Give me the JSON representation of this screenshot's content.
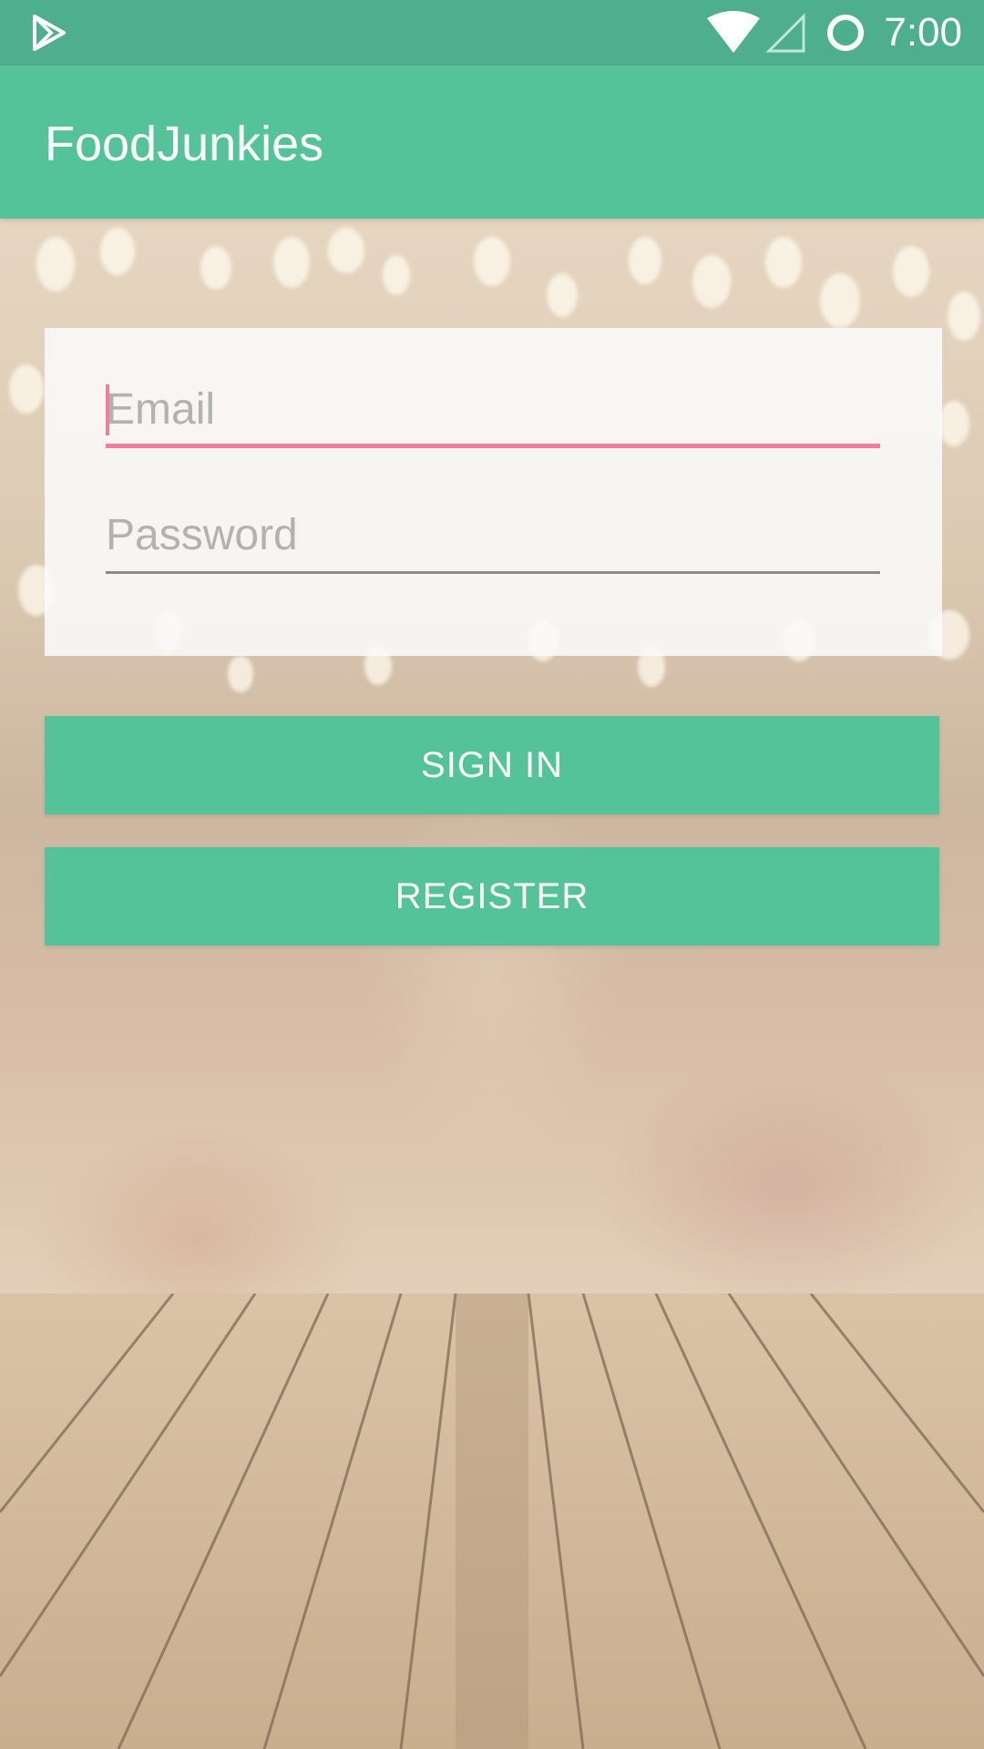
{
  "status_bar": {
    "time": "7:00",
    "icons": [
      "play-store-icon",
      "wifi-icon",
      "cell-signal-icon",
      "battery-icon"
    ]
  },
  "app_bar": {
    "title": "FoodJunkies"
  },
  "login_form": {
    "email_placeholder": "Email",
    "email_value": "",
    "password_placeholder": "Password",
    "password_value": ""
  },
  "buttons": {
    "sign_in_label": "SIGN IN",
    "register_label": "REGISTER"
  },
  "colors": {
    "status_bar": "#4daf8e",
    "primary": "#55c39a",
    "accent": "#f47ba1"
  }
}
